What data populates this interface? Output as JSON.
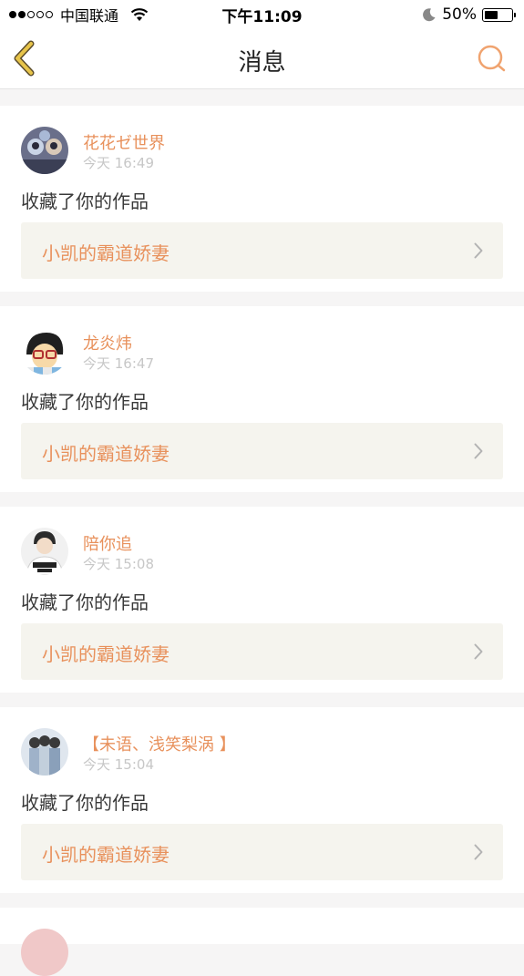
{
  "status_bar": {
    "carrier": "中国联通",
    "time": "下午11:09",
    "battery_text": "50%",
    "battery_level": 0.5,
    "signal_bars_filled": 2,
    "signal_bars_total": 5
  },
  "nav": {
    "title": "消息",
    "back_icon": "chevron-left-icon",
    "search_icon": "search-icon",
    "accent_color": "#f0a36f",
    "back_color": "#e7c44a"
  },
  "colors": {
    "username": "#e8915c",
    "work_title": "#e8915c",
    "timestamp": "#c7c7c7",
    "card_link_bg": "#f5f4ee",
    "page_bg": "#f6f5f5"
  },
  "messages": [
    {
      "username": "花花ゼ世界",
      "time": "今天 16:49",
      "action": "收藏了你的作品",
      "work_title": "小凯的霸道娇妻"
    },
    {
      "username": "龙炎炜",
      "time": "今天 16:47",
      "action": "收藏了你的作品",
      "work_title": "小凯的霸道娇妻"
    },
    {
      "username": "陪你追",
      "time": "今天 15:08",
      "action": "收藏了你的作品",
      "work_title": "小凯的霸道娇妻"
    },
    {
      "username": "【未语、浅笑梨涡 】",
      "time": "今天 15:04",
      "action": "收藏了你的作品",
      "work_title": "小凯的霸道娇妻"
    }
  ]
}
